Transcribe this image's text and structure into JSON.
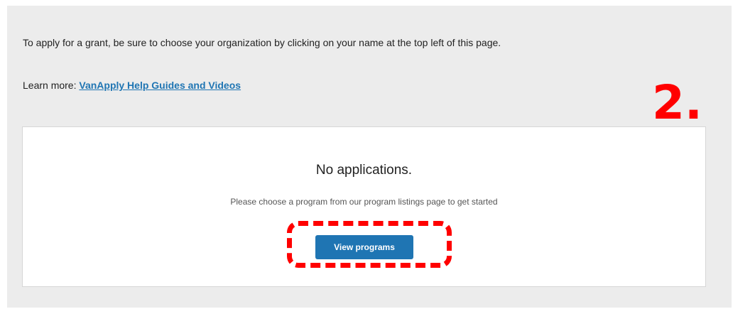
{
  "intro": {
    "text": "To apply for a grant, be sure to choose your organization by clicking on your name at the top left of this page."
  },
  "learn_more": {
    "prefix": "Learn more: ",
    "link_text": "VanApply Help Guides and Videos"
  },
  "annotation": {
    "step_number": "2.",
    "color": "#ff0000"
  },
  "empty_state": {
    "title": "No applications.",
    "message": "Please choose a program from our program listings page to get started",
    "button_label": "View programs"
  },
  "colors": {
    "panel_bg": "#ececec",
    "link": "#1f75b3",
    "button_bg": "#1f75b3",
    "button_text": "#ffffff"
  }
}
